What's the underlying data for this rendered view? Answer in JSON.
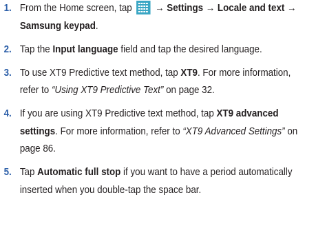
{
  "steps": [
    {
      "number": "1.",
      "t1": "From the Home screen, tap",
      "t2": " → Settings → Locale and text → Samsung keypad",
      "t3": "."
    },
    {
      "number": "2.",
      "t1": "Tap the ",
      "t2": "Input language",
      "t3": " field and tap the desired language."
    },
    {
      "number": "3.",
      "t1": "To use XT9 Predictive text method, tap ",
      "t2": "XT9",
      "t3": ". For more information, refer to ",
      "t4": "“Using XT9 Predictive Text”",
      "t5": " on page 32."
    },
    {
      "number": "4.",
      "t1": "If you are using XT9 Predictive text method, tap ",
      "t2": "XT9 advanced settings",
      "t3": ". For more information, refer to ",
      "t4": "“XT9 Advanced Settings”",
      "t5": " on page 86."
    },
    {
      "number": "5.",
      "t1": "Tap ",
      "t2": "Automatic full stop",
      "t3": " if you want to have a period automatically inserted when you double-tap the space bar."
    }
  ],
  "icons": {
    "apps": "apps-grid-icon"
  },
  "colors": {
    "step_number": "#2b5ea8",
    "icon_bg": "#3aa6c4",
    "text": "#231f20"
  }
}
